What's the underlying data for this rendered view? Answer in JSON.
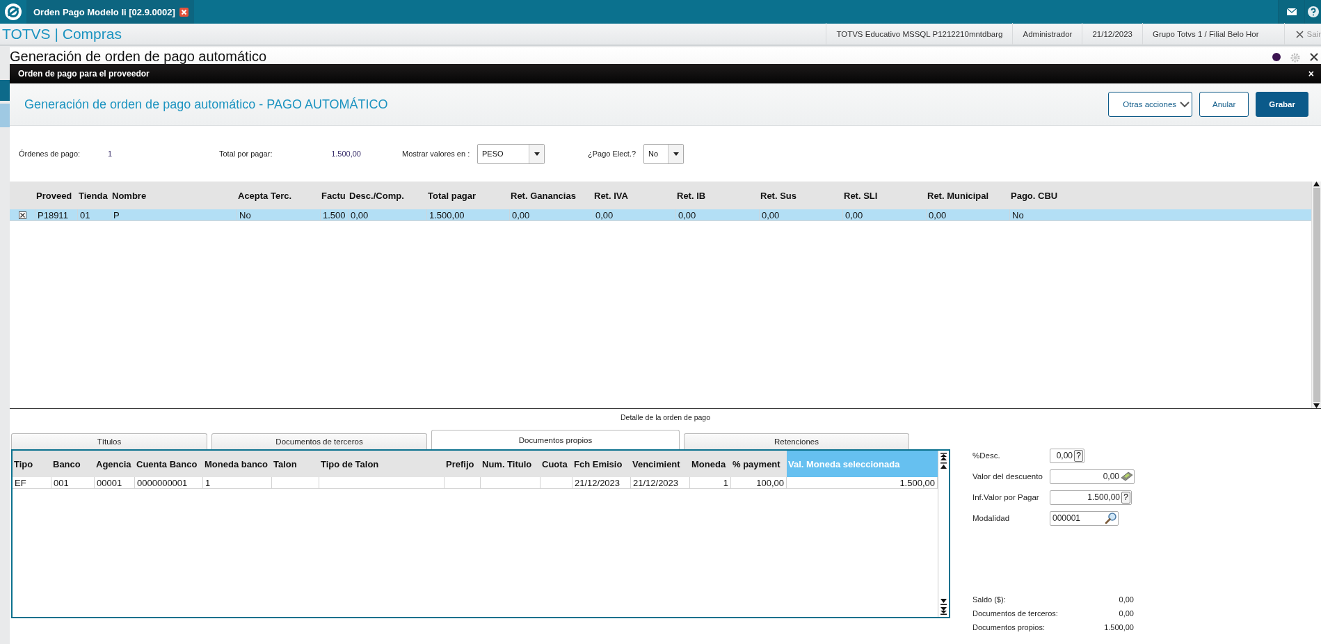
{
  "app_tab": {
    "title": "Orden Pago Modelo Ii [02.9.0002]"
  },
  "header": {
    "brand": "TOTVS | Compras",
    "info": [
      "TOTVS Educativo MSSQL P1212210mntdbarg",
      "Administrador",
      "21/12/2023",
      "Grupo Totvs 1 / Filial Belo Hor"
    ],
    "logout": "Sair"
  },
  "background_page": {
    "title": "Generación de orden de pago automático"
  },
  "dialog": {
    "title": "Orden de pago para el proveedor",
    "close": "×",
    "heading": "Generación de orden de pago automático - PAGO AUTOMÁTICO",
    "actions": [
      {
        "label": "Otras acciones",
        "kind": "menu"
      },
      {
        "label": "Anular",
        "kind": "secondary"
      },
      {
        "label": "Grabar",
        "kind": "primary"
      }
    ]
  },
  "summary": {
    "orders_label": "Órdenes de pago:",
    "orders_value": "1",
    "total_label": "Total por pagar:",
    "total_value": "1.500,00",
    "currency_label": "Mostrar valores en :",
    "currency_value": "PESO",
    "electronic_label": "¿Pago Elect.?",
    "electronic_value": "No"
  },
  "suppliers_table": {
    "columns": [
      "Proveed",
      "Tienda",
      "Nombre",
      "Acepta Terc.",
      "Factu",
      "Desc./Comp.",
      "Total pagar",
      "Ret. Ganancias",
      "Ret. IVA",
      "Ret. IB",
      "Ret. Sus",
      "Ret. SLI",
      "Ret. Municipal",
      "Pago. CBU"
    ],
    "rows": [
      {
        "selected": true,
        "marked": true,
        "cells": [
          "P18911",
          "01",
          "P",
          "No",
          "1.500",
          "0,00",
          "1.500,00",
          "0,00",
          "0,00",
          "0,00",
          "0,00",
          "0,00",
          "0,00",
          "No"
        ]
      }
    ]
  },
  "detail": {
    "caption": "Detalle de la orden de pago",
    "tabs": [
      {
        "label": "Títulos",
        "selected": false
      },
      {
        "label": "Documentos de terceros",
        "selected": false
      },
      {
        "label": "Documentos propios",
        "selected": true
      },
      {
        "label": "Retenciones",
        "selected": false
      }
    ],
    "table": {
      "columns": [
        {
          "label": "Tipo",
          "selected": false
        },
        {
          "label": "Banco",
          "selected": false
        },
        {
          "label": "Agencia",
          "selected": false
        },
        {
          "label": "Cuenta Banco",
          "selected": false
        },
        {
          "label": "Moneda banco",
          "selected": false
        },
        {
          "label": "Talon",
          "selected": false
        },
        {
          "label": "Tipo de Talon",
          "selected": false
        },
        {
          "label": "Prefijo",
          "selected": false
        },
        {
          "label": "Num. Titulo",
          "selected": false
        },
        {
          "label": "Cuota",
          "selected": false
        },
        {
          "label": "Fch Emisio",
          "selected": false
        },
        {
          "label": "Vencimient",
          "selected": false
        },
        {
          "label": "Moneda",
          "selected": false
        },
        {
          "label": "% payment",
          "selected": false
        },
        {
          "label": "Val. Moneda seleccionada",
          "selected": true
        }
      ],
      "rows": [
        {
          "cells": [
            "EF",
            "001",
            "00001",
            "0000000001",
            "1",
            null,
            null,
            null,
            null,
            null,
            "21/12/2023",
            "21/12/2023",
            "1",
            "100,00",
            "1.500,00"
          ]
        }
      ]
    }
  },
  "side_fields": [
    {
      "label": "%Desc.",
      "value": "0,00",
      "kind": "help",
      "button": "?"
    },
    {
      "label": "Valor del descuento",
      "value": "0,00",
      "kind": "calculator"
    },
    {
      "label": "Inf.Valor por Pagar",
      "value": "1.500,00",
      "kind": "help",
      "button": "?"
    },
    {
      "label": "Modalidad",
      "value": "000001",
      "kind": "lookup"
    }
  ],
  "totals": [
    {
      "label": "Saldo ($):",
      "value": "0,00"
    },
    {
      "label": "Documentos de terceros:",
      "value": "0,00"
    },
    {
      "label": "Documentos propios:",
      "value": "1.500,00"
    }
  ]
}
